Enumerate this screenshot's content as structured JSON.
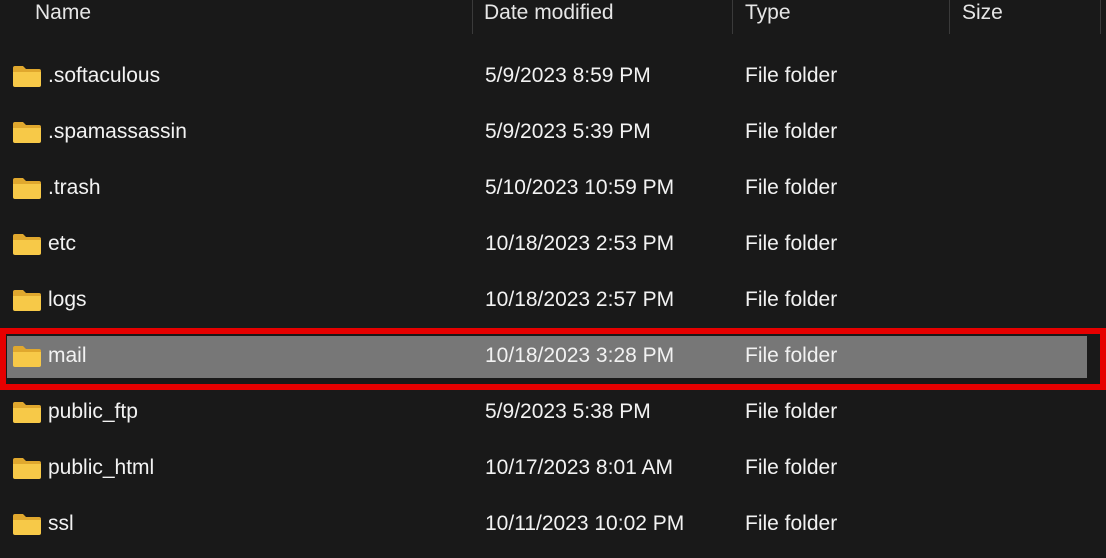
{
  "columns": [
    {
      "key": "name",
      "label": "Name"
    },
    {
      "key": "date",
      "label": "Date modified"
    },
    {
      "key": "type",
      "label": "Type"
    },
    {
      "key": "size",
      "label": "Size"
    }
  ],
  "rows": [
    {
      "name": ".softaculous",
      "date": "5/9/2023 8:59 PM",
      "type": "File folder",
      "size": "",
      "selected": false
    },
    {
      "name": ".spamassassin",
      "date": "5/9/2023 5:39 PM",
      "type": "File folder",
      "size": "",
      "selected": false
    },
    {
      "name": ".trash",
      "date": "5/10/2023 10:59 PM",
      "type": "File folder",
      "size": "",
      "selected": false
    },
    {
      "name": "etc",
      "date": "10/18/2023 2:53 PM",
      "type": "File folder",
      "size": "",
      "selected": false
    },
    {
      "name": "logs",
      "date": "10/18/2023 2:57 PM",
      "type": "File folder",
      "size": "",
      "selected": false
    },
    {
      "name": "mail",
      "date": "10/18/2023 3:28 PM",
      "type": "File folder",
      "size": "",
      "selected": true
    },
    {
      "name": "public_ftp",
      "date": "5/9/2023 5:38 PM",
      "type": "File folder",
      "size": "",
      "selected": false
    },
    {
      "name": "public_html",
      "date": "10/17/2023 8:01 AM",
      "type": "File folder",
      "size": "",
      "selected": false
    },
    {
      "name": "ssl",
      "date": "10/11/2023 10:02 PM",
      "type": "File folder",
      "size": "",
      "selected": false
    }
  ],
  "icons": {
    "folder": "folder-icon"
  },
  "colors": {
    "background": "#191919",
    "selection": "#777777",
    "highlight_border": "#e60000",
    "folder_body": "#f7c948",
    "folder_tab": "#e0a82e"
  }
}
